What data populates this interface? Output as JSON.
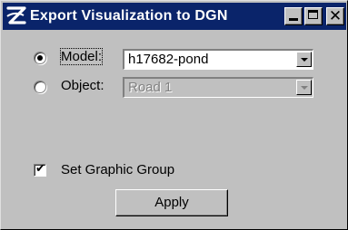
{
  "window": {
    "title": "Export Visualization to DGN",
    "title_bar_color": "#0a246a",
    "app_icon": "microstation-logo-icon"
  },
  "caption_buttons": {
    "minimize_icon": "minimize-icon",
    "maximize_icon": "maximize-icon",
    "close_icon": "close-icon",
    "close_glyph": "✕"
  },
  "model": {
    "label": "Model:",
    "selected": true,
    "value": "h17682-pond"
  },
  "object": {
    "label": "Object:",
    "selected": false,
    "value": "Road 1",
    "disabled": true
  },
  "set_graphic_group": {
    "label": "Set Graphic Group",
    "checked": true,
    "check_glyph": "✔"
  },
  "apply_button": {
    "label": "Apply"
  }
}
